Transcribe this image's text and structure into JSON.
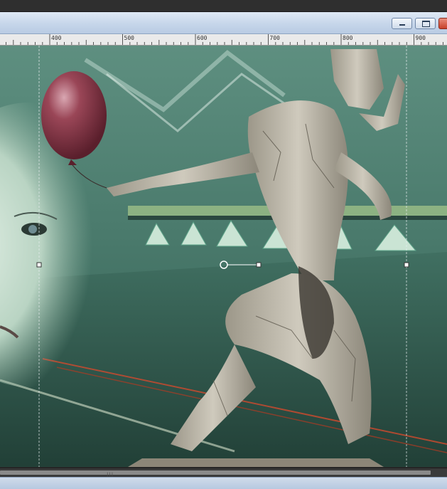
{
  "window": {
    "buttons": {
      "minimize": "minimize",
      "maximize": "maximize",
      "close": "close"
    }
  },
  "ruler": {
    "labels": [
      "400",
      "500",
      "600",
      "700",
      "800",
      "900"
    ]
  },
  "scrollbar": {
    "grip": "|||"
  },
  "colors": {
    "canvas_bg": "#4f7d70",
    "balloon": "#8a3c4a",
    "window_chrome": "#c6d6ea"
  }
}
